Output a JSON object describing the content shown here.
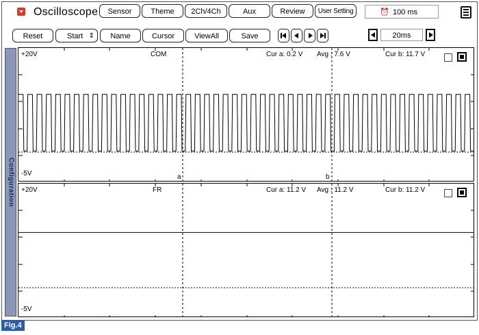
{
  "app": {
    "title": "Oscilloscope"
  },
  "toolbar_top": [
    "Sensor",
    "Theme",
    "2Ch/4Ch",
    "Aux",
    "Review",
    "User Setting"
  ],
  "time_per_div": "100 ms",
  "toolbar_bottom": {
    "reset": "Reset",
    "start": "Start",
    "start_arrow": "⇕",
    "name": "Name",
    "cursor": "Cursor",
    "viewall": "ViewAll",
    "save": "Save"
  },
  "zoom": "20ms",
  "side_tab": "Configuration",
  "channels": [
    {
      "name": "COM",
      "ymax": "+20V",
      "ymin": "-5V",
      "cur_a": "Cur a: 0.2 V",
      "avg": "Avg : 7.6 V",
      "cur_b": "Cur b: 11.7 V",
      "cursor_a_label": "a",
      "cursor_b_label": "b",
      "signal": "square-wave"
    },
    {
      "name": "FR",
      "ymax": "+20V",
      "ymin": "-5V",
      "cur_a": "Cur a: 11.2 V",
      "avg": "Avg : 11.2 V",
      "cur_b": "Cur b: 11.2 V",
      "signal": "flat"
    }
  ],
  "figure_label": "Fig.4",
  "icons": {
    "app": "dropdown-icon",
    "clock": "clock-icon",
    "menu": "menu-icon",
    "nav": [
      "first-icon",
      "prev-icon",
      "next-icon",
      "last-icon"
    ],
    "zoom": [
      "zoom-out-icon",
      "zoom-in-icon"
    ]
  },
  "colors": {
    "sidetab": "#8a97b8",
    "figlabel": "#2a5ca8",
    "app_icon": "#d63a2a"
  }
}
